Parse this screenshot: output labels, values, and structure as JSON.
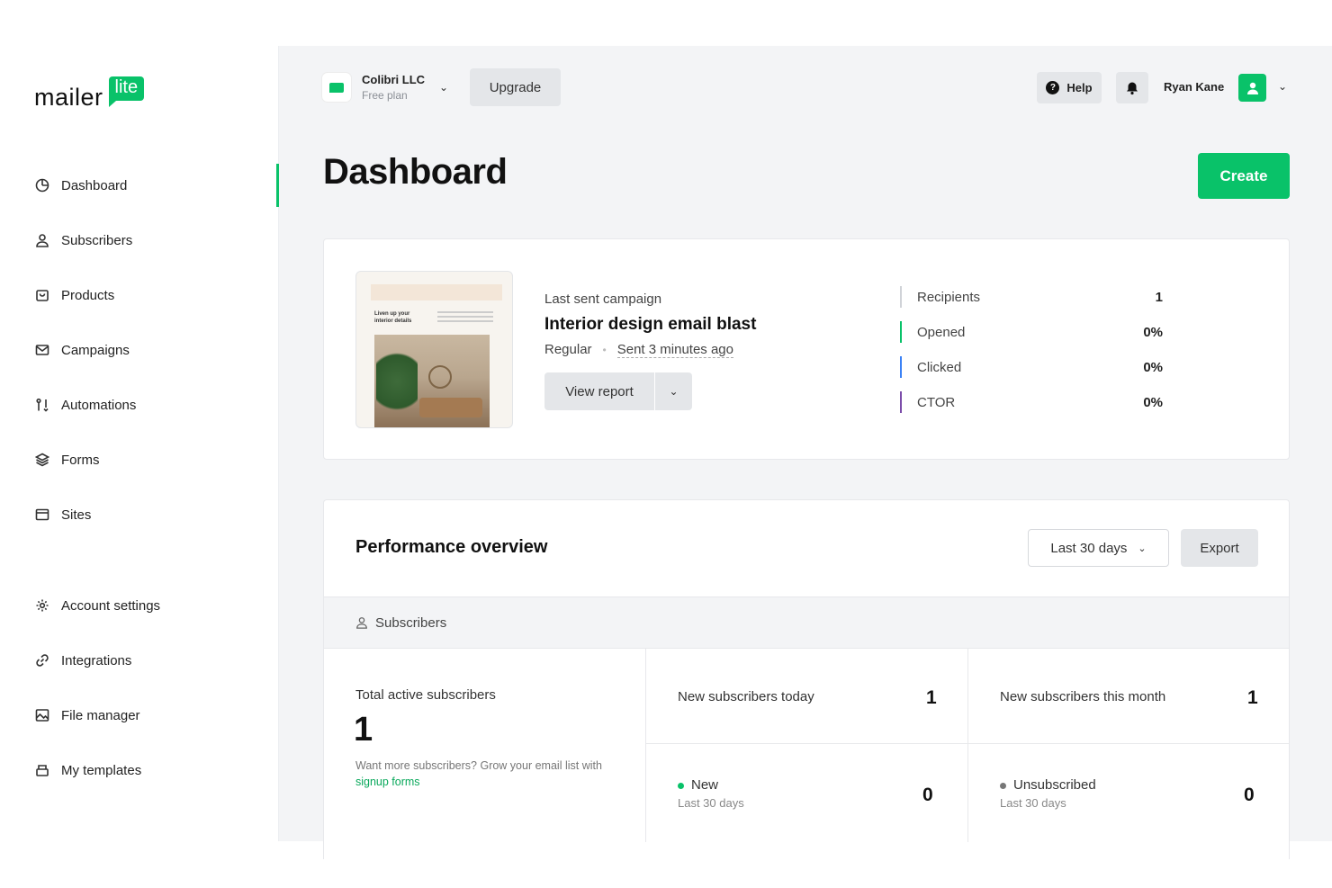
{
  "brand": {
    "logo_text": "mailer",
    "logo_badge": "lite",
    "accent": "#09c269"
  },
  "sidebar": {
    "items": [
      {
        "label": "Dashboard",
        "icon": "dashboard-icon"
      },
      {
        "label": "Subscribers",
        "icon": "user-icon"
      },
      {
        "label": "Products",
        "icon": "shopping-bag-icon"
      },
      {
        "label": "Campaigns",
        "icon": "envelope-icon"
      },
      {
        "label": "Automations",
        "icon": "automation-icon"
      },
      {
        "label": "Forms",
        "icon": "layers-icon"
      },
      {
        "label": "Sites",
        "icon": "browser-icon"
      },
      {
        "label": "Account settings",
        "icon": "gear-icon"
      },
      {
        "label": "Integrations",
        "icon": "link-icon"
      },
      {
        "label": "File manager",
        "icon": "image-icon"
      },
      {
        "label": "My templates",
        "icon": "templates-icon"
      }
    ],
    "active": "Dashboard"
  },
  "header": {
    "org_name": "Colibri LLC",
    "org_plan": "Free plan",
    "upgrade_label": "Upgrade",
    "help_label": "Help",
    "user_name": "Ryan Kane"
  },
  "page": {
    "title": "Dashboard",
    "create_label": "Create"
  },
  "campaign": {
    "section_label": "Last sent campaign",
    "name": "Interior design email blast",
    "type": "Regular",
    "sent": "Sent 3 minutes ago",
    "view_report_label": "View report",
    "thumb_title": "Liven up your interior details",
    "stats": [
      {
        "label": "Recipients",
        "value": "1",
        "color": "#d0d3d8"
      },
      {
        "label": "Opened",
        "value": "0%",
        "color": "#09c269"
      },
      {
        "label": "Clicked",
        "value": "0%",
        "color": "#3b82f6"
      },
      {
        "label": "CTOR",
        "value": "0%",
        "color": "#7c4daa"
      }
    ]
  },
  "performance": {
    "title": "Performance overview",
    "range_label": "Last 30 days",
    "export_label": "Export",
    "section_label": "Subscribers",
    "total_label": "Total active subscribers",
    "total_value": "1",
    "hint_text": "Want more subscribers? Grow your email list with",
    "hint_link": "signup forms",
    "today_label": "New subscribers today",
    "today_value": "1",
    "month_label": "New subscribers this month",
    "month_value": "1",
    "new_label": "New",
    "new_sub": "Last 30 days",
    "new_value": "0",
    "unsub_label": "Unsubscribed",
    "unsub_sub": "Last 30 days",
    "unsub_value": "0"
  }
}
